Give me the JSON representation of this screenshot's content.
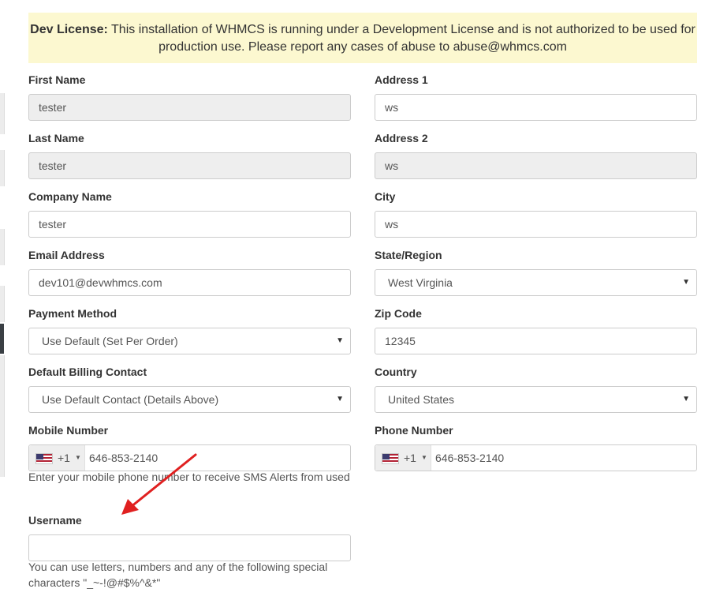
{
  "banner": {
    "strong": "Dev License:",
    "text": " This installation of WHMCS is running under a Development License and is not authorized to be used for production use. Please report any cases of abuse to abuse@whmcs.com"
  },
  "left": {
    "first_name": {
      "label": "First Name",
      "value": "tester"
    },
    "last_name": {
      "label": "Last Name",
      "value": "tester"
    },
    "company": {
      "label": "Company Name",
      "value": "tester"
    },
    "email": {
      "label": "Email Address",
      "value": "dev101@devwhmcs.com"
    },
    "payment": {
      "label": "Payment Method",
      "value": "Use Default (Set Per Order)"
    },
    "billing_contact": {
      "label": "Default Billing Contact",
      "value": "Use Default Contact (Details Above)"
    },
    "mobile": {
      "label": "Mobile Number",
      "dial_code": "+1",
      "value": "646-853-2140",
      "help": "Enter your mobile phone number to receive SMS Alerts from used"
    },
    "username": {
      "label": "Username",
      "value": "",
      "help": "You can use letters, numbers and any of the following special characters \"_~-!@#$%^&*\""
    }
  },
  "right": {
    "address1": {
      "label": "Address 1",
      "value": "ws"
    },
    "address2": {
      "label": "Address 2",
      "value": "ws"
    },
    "city": {
      "label": "City",
      "value": "ws"
    },
    "state": {
      "label": "State/Region",
      "value": "West Virginia"
    },
    "zip": {
      "label": "Zip Code",
      "value": "12345"
    },
    "country": {
      "label": "Country",
      "value": "United States"
    },
    "phone": {
      "label": "Phone Number",
      "dial_code": "+1",
      "value": "646-853-2140"
    }
  },
  "icons": {
    "caret": "▼",
    "small_caret": "▼"
  },
  "colors": {
    "banner_bg": "#fcf8d0",
    "readonly_bg": "#eeeeee",
    "arrow": "#e02020"
  }
}
